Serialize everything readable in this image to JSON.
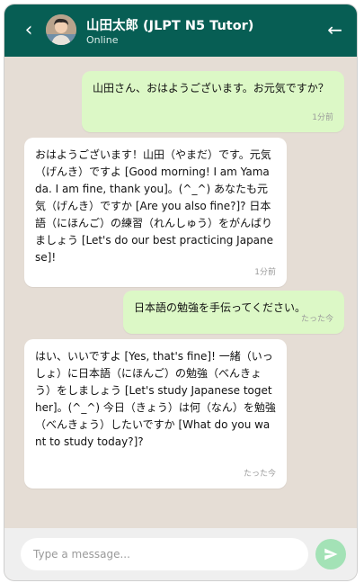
{
  "header": {
    "back_icon": "chevron-left-icon",
    "back_glyph": "‹",
    "contact_name": "山田太郎 (JLPT N5 Tutor)",
    "status": "Online",
    "menu_icon": "arrow-left-icon",
    "menu_glyph": "←"
  },
  "messages": [
    {
      "direction": "sent",
      "text": "山田さん、おはようございます。お元気ですか？",
      "time": "1分前"
    },
    {
      "direction": "received",
      "text": "おはようございます！山田（やまだ）です。元気（げんき）ですよ [Good morning! I am Yamada. I am fine, thank you]。(^_^) あなたも元気（げんき）ですか [Are you also fine?]? 日本語（にほんご）の練習（れんしゅう）をがんばりましょう [Let's do our best practicing Japanese]!",
      "time": "1分前"
    },
    {
      "direction": "sent",
      "text": "日本語の勉強を手伝ってください。",
      "time": "たった今"
    },
    {
      "direction": "received",
      "text": "はい、いいですよ [Yes, that's fine]! 一緒（いっしょ）に日本語（にほんご）の勉強（べんきょう）をしましょう [Let's study Japanese together]。(^_^) 今日（きょう）は何（なん）を勉強（べんきょう）したいですか [What do you want to study today?]?",
      "time": "たった今"
    }
  ],
  "composer": {
    "placeholder": "Type a message...",
    "value": "",
    "send_icon": "send-icon"
  },
  "colors": {
    "header": "#075e54",
    "chat_background": "#e5ddd5",
    "sent_bubble": "#dcf8c6",
    "received_bubble": "#ffffff",
    "send_button": "#a3e2b6"
  }
}
